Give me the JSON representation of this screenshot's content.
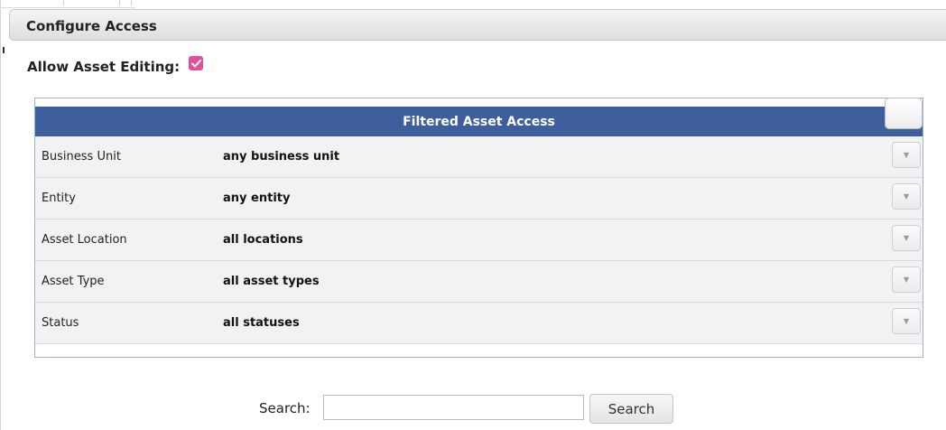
{
  "panel": {
    "title": "Configure Access"
  },
  "allow_editing": {
    "label": "Allow Asset Editing:",
    "checked": true,
    "check_color": "#e0519d"
  },
  "access_table": {
    "title": "Filtered Asset Access",
    "header_color": "#3e5e9c",
    "rows": [
      {
        "label": "Business Unit",
        "value": "any business unit",
        "icon": "dropdown-arrow-icon"
      },
      {
        "label": "Entity",
        "value": "any entity",
        "icon": "dropdown-arrow-icon"
      },
      {
        "label": "Asset Location",
        "value": "all locations",
        "icon": "dropdown-arrow-icon"
      },
      {
        "label": "Asset Type",
        "value": "all asset types",
        "icon": "dropdown-arrow-icon"
      },
      {
        "label": "Status",
        "value": "all statuses",
        "icon": "dropdown-arrow-icon"
      }
    ]
  },
  "search": {
    "label": "Search:",
    "value": "",
    "placeholder": "",
    "button_label": "Search"
  }
}
